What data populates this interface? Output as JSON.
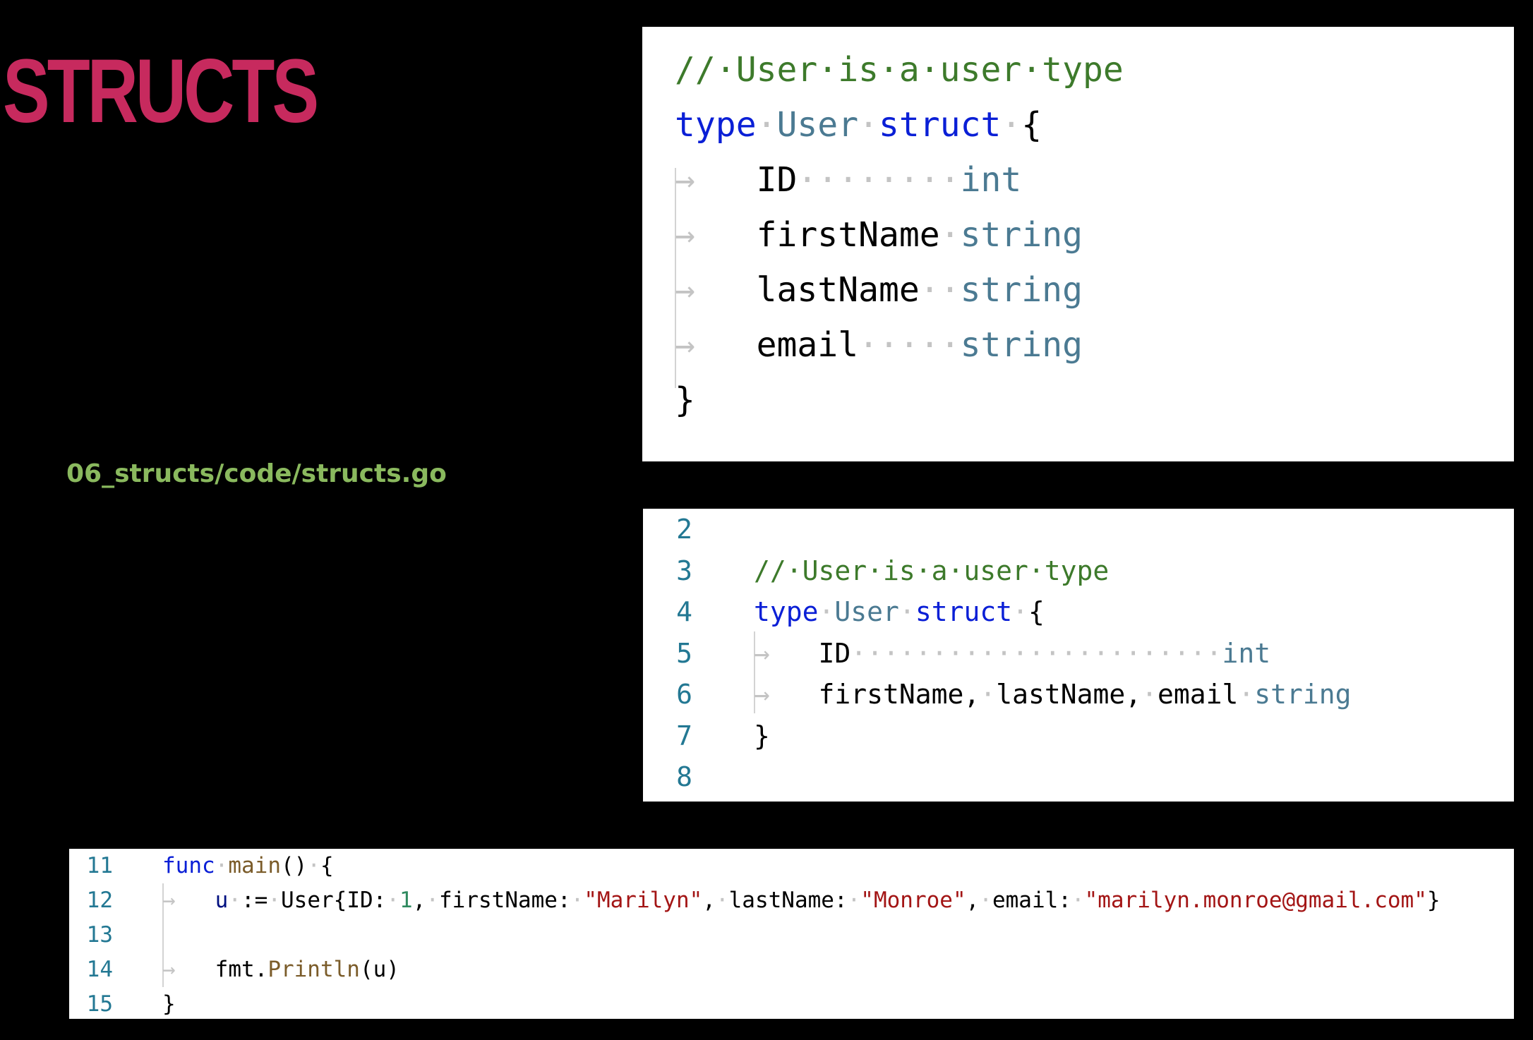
{
  "slide": {
    "title": "STRUCTS",
    "file_path": "06_structs/code/structs.go"
  },
  "colors": {
    "background": "#000000",
    "title": "#c72a5e",
    "file_path": "#8ab95e",
    "panel_background": "#ffffff",
    "line_number": "#237893",
    "comment": "#3d7a2b",
    "keyword": "#0a1fd6",
    "type": "#4b7a92",
    "function": "#7b5c2a",
    "string": "#a31515",
    "number": "#2f8a5f",
    "variable": "#001080",
    "whitespace_marker": "#c4c4c4"
  },
  "whitespace_glyphs": {
    "space": "·",
    "tab": "→"
  },
  "panels": {
    "top": {
      "lines": [
        {
          "number": "",
          "tokens": [
            {
              "t": "//·User·is·a·user·type",
              "k": "comment"
            }
          ]
        },
        {
          "number": "",
          "tokens": [
            {
              "t": "type",
              "k": "keyword"
            },
            {
              "t": "·",
              "k": "ws"
            },
            {
              "t": "User",
              "k": "type"
            },
            {
              "t": "·",
              "k": "ws"
            },
            {
              "t": "struct",
              "k": "keyword"
            },
            {
              "t": "·",
              "k": "ws"
            },
            {
              "t": "{",
              "k": "plain"
            }
          ]
        },
        {
          "number": "",
          "tokens": [
            {
              "t": "→   ",
              "k": "tab"
            },
            {
              "t": "ID",
              "k": "plain"
            },
            {
              "t": "········",
              "k": "ws"
            },
            {
              "t": "int",
              "k": "type"
            }
          ]
        },
        {
          "number": "",
          "tokens": [
            {
              "t": "→   ",
              "k": "tab"
            },
            {
              "t": "firstName",
              "k": "plain"
            },
            {
              "t": "·",
              "k": "ws"
            },
            {
              "t": "string",
              "k": "type"
            }
          ]
        },
        {
          "number": "",
          "tokens": [
            {
              "t": "→   ",
              "k": "tab"
            },
            {
              "t": "lastName",
              "k": "plain"
            },
            {
              "t": "··",
              "k": "ws"
            },
            {
              "t": "string",
              "k": "type"
            }
          ]
        },
        {
          "number": "",
          "tokens": [
            {
              "t": "→   ",
              "k": "tab"
            },
            {
              "t": "email",
              "k": "plain"
            },
            {
              "t": "·····",
              "k": "ws"
            },
            {
              "t": "string",
              "k": "type"
            }
          ]
        },
        {
          "number": "",
          "tokens": [
            {
              "t": "}",
              "k": "plain"
            }
          ]
        }
      ]
    },
    "middle": {
      "lines": [
        {
          "number": "2",
          "tokens": []
        },
        {
          "number": "3",
          "tokens": [
            {
              "t": "//·User·is·a·user·type",
              "k": "comment"
            }
          ]
        },
        {
          "number": "4",
          "tokens": [
            {
              "t": "type",
              "k": "keyword"
            },
            {
              "t": "·",
              "k": "ws"
            },
            {
              "t": "User",
              "k": "type"
            },
            {
              "t": "·",
              "k": "ws"
            },
            {
              "t": "struct",
              "k": "keyword"
            },
            {
              "t": "·",
              "k": "ws"
            },
            {
              "t": "{",
              "k": "plain"
            }
          ]
        },
        {
          "number": "5",
          "tokens": [
            {
              "t": "→   ",
              "k": "tab"
            },
            {
              "t": "ID",
              "k": "plain"
            },
            {
              "t": "·······················",
              "k": "ws"
            },
            {
              "t": "int",
              "k": "type"
            }
          ]
        },
        {
          "number": "6",
          "tokens": [
            {
              "t": "→   ",
              "k": "tab"
            },
            {
              "t": "firstName,",
              "k": "plain"
            },
            {
              "t": "·",
              "k": "ws"
            },
            {
              "t": "lastName,",
              "k": "plain"
            },
            {
              "t": "·",
              "k": "ws"
            },
            {
              "t": "email",
              "k": "plain"
            },
            {
              "t": "·",
              "k": "ws"
            },
            {
              "t": "string",
              "k": "type"
            }
          ]
        },
        {
          "number": "7",
          "tokens": [
            {
              "t": "}",
              "k": "plain"
            }
          ]
        },
        {
          "number": "8",
          "tokens": []
        }
      ]
    },
    "bottom": {
      "lines": [
        {
          "number": "11",
          "tokens": [
            {
              "t": "func",
              "k": "keyword"
            },
            {
              "t": "·",
              "k": "ws"
            },
            {
              "t": "main",
              "k": "function"
            },
            {
              "t": "()",
              "k": "plain"
            },
            {
              "t": "·",
              "k": "ws"
            },
            {
              "t": "{",
              "k": "plain"
            }
          ]
        },
        {
          "number": "12",
          "tokens": [
            {
              "t": "→   ",
              "k": "tab"
            },
            {
              "t": "u",
              "k": "variable"
            },
            {
              "t": "·",
              "k": "ws"
            },
            {
              "t": ":=",
              "k": "plain"
            },
            {
              "t": "·",
              "k": "ws"
            },
            {
              "t": "User{ID:",
              "k": "plain"
            },
            {
              "t": "·",
              "k": "ws"
            },
            {
              "t": "1",
              "k": "number"
            },
            {
              "t": ",",
              "k": "plain"
            },
            {
              "t": "·",
              "k": "ws"
            },
            {
              "t": "firstName:",
              "k": "plain"
            },
            {
              "t": "·",
              "k": "ws"
            },
            {
              "t": "\"Marilyn\"",
              "k": "string"
            },
            {
              "t": ",",
              "k": "plain"
            },
            {
              "t": "·",
              "k": "ws"
            },
            {
              "t": "lastName:",
              "k": "plain"
            },
            {
              "t": "·",
              "k": "ws"
            },
            {
              "t": "\"Monroe\"",
              "k": "string"
            },
            {
              "t": ",",
              "k": "plain"
            },
            {
              "t": "·",
              "k": "ws"
            },
            {
              "t": "email:",
              "k": "plain"
            },
            {
              "t": "·",
              "k": "ws"
            },
            {
              "t": "\"marilyn.monroe@gmail.com\"",
              "k": "string"
            },
            {
              "t": "}",
              "k": "plain"
            }
          ]
        },
        {
          "number": "13",
          "tokens": []
        },
        {
          "number": "14",
          "tokens": [
            {
              "t": "→   ",
              "k": "tab"
            },
            {
              "t": "fmt.",
              "k": "plain"
            },
            {
              "t": "Println",
              "k": "function"
            },
            {
              "t": "(u)",
              "k": "plain"
            }
          ]
        },
        {
          "number": "15",
          "tokens": [
            {
              "t": "}",
              "k": "plain"
            }
          ]
        }
      ]
    }
  }
}
